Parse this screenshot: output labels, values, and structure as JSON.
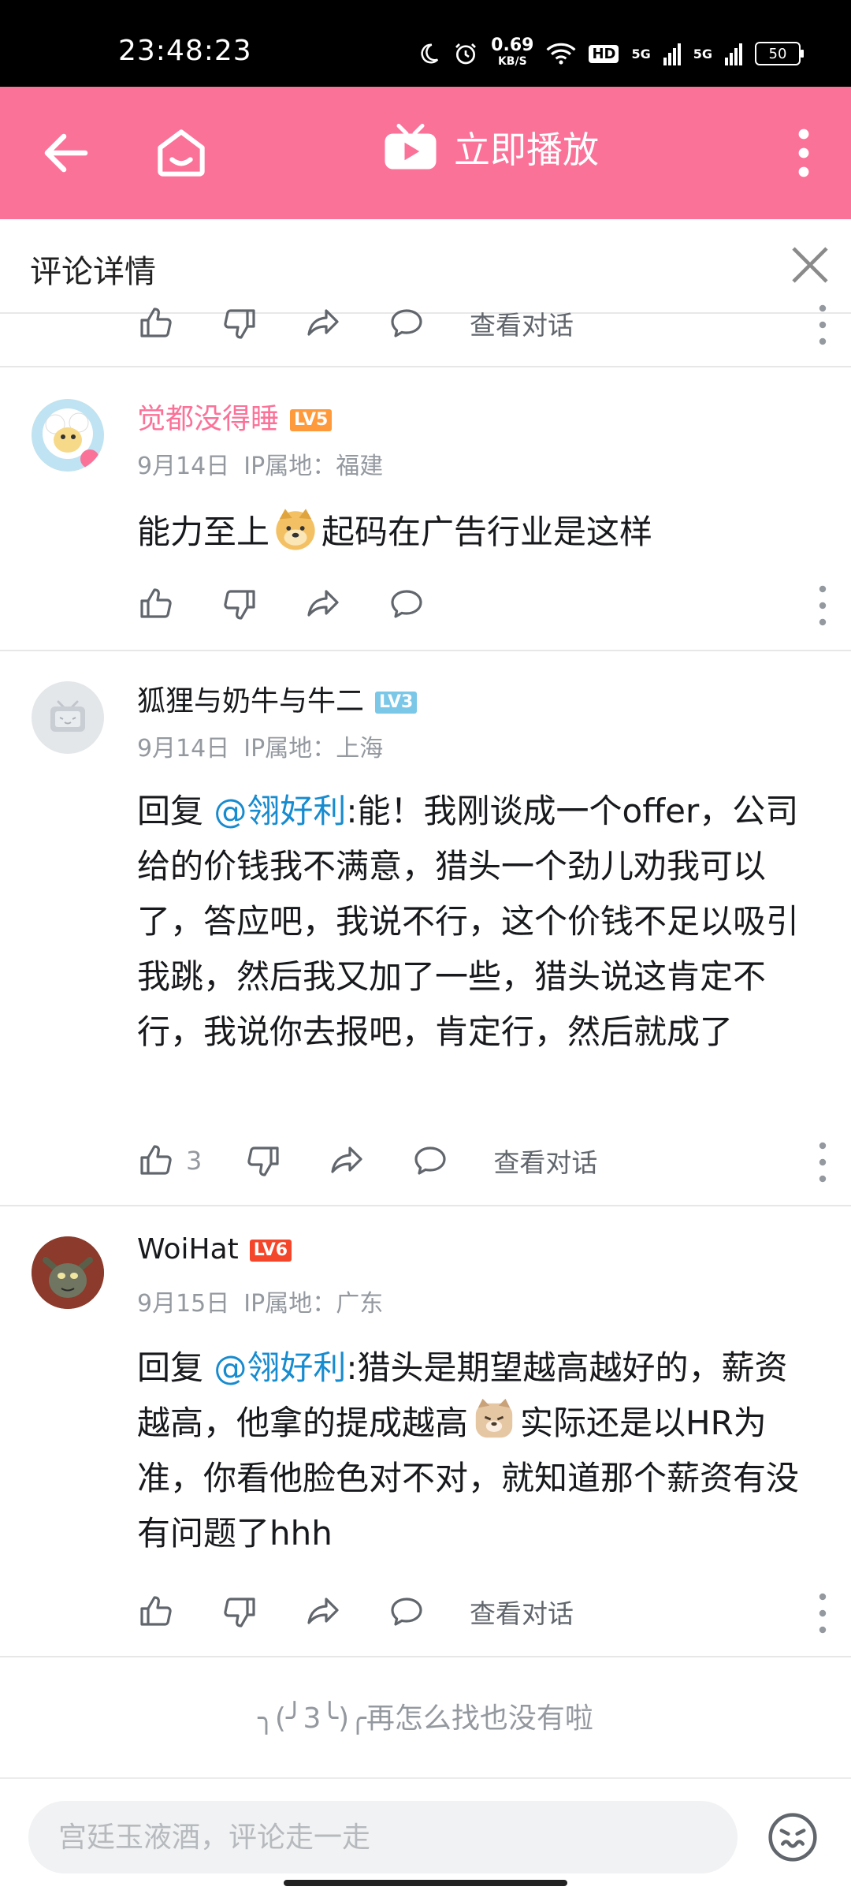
{
  "status_bar": {
    "time": "23:48:23",
    "net_speed": "0.69",
    "net_unit": "KB/S",
    "hd": "HD",
    "sig1": "5G",
    "sig2": "5G",
    "battery": "50"
  },
  "nav": {
    "play_label": "立即播放"
  },
  "page": {
    "title": "评论详情"
  },
  "top_row": {
    "view_conversation": "查看对话"
  },
  "comments": [
    {
      "username": "觉都没得睡",
      "level": "LV5",
      "date": "9月14日",
      "ip": "IP属地：福建",
      "text_before": "能力至上",
      "text_after": "起码在广告行业是这样"
    },
    {
      "username": "狐狸与奶牛与牛二",
      "level": "LV3",
      "date": "9月14日",
      "ip": "IP属地：上海",
      "reply_prefix": "回复 ",
      "mention": "@翎好利",
      "text": ":能！我刚谈成一个offer，公司给的价钱我不满意，猎头一个劲儿劝我可以了，答应吧，我说不行，这个价钱不足以吸引我跳，然后我又加了一些，猎头说这肯定不行，我说你去报吧，肯定行，然后就成了",
      "likes": "3",
      "view_conversation": "查看对话"
    },
    {
      "username": "WoiHat",
      "level": "LV6",
      "date": "9月15日",
      "ip": "IP属地：广东",
      "reply_prefix": "回复 ",
      "mention": "@翎好利",
      "text_before": ":猎头是期望越高越好的，薪资越高，他拿的提成越高",
      "text_after": "实际还是以HR为准，你看他脸色对不对，就知道那个薪资有没有问题了hhh",
      "view_conversation": "查看对话"
    }
  ],
  "end_text": "╮(╯3╰)╭再怎么找也没有啦",
  "input": {
    "placeholder": "宫廷玉液酒，评论走一走"
  },
  "colors": {
    "brand_pink": "#fb7299",
    "username_pink": "#fb7299",
    "mention_blue": "#178bcf",
    "lv5": "#ff9a3c",
    "lv3": "#7bc7e8",
    "lv6": "#f4462a"
  }
}
